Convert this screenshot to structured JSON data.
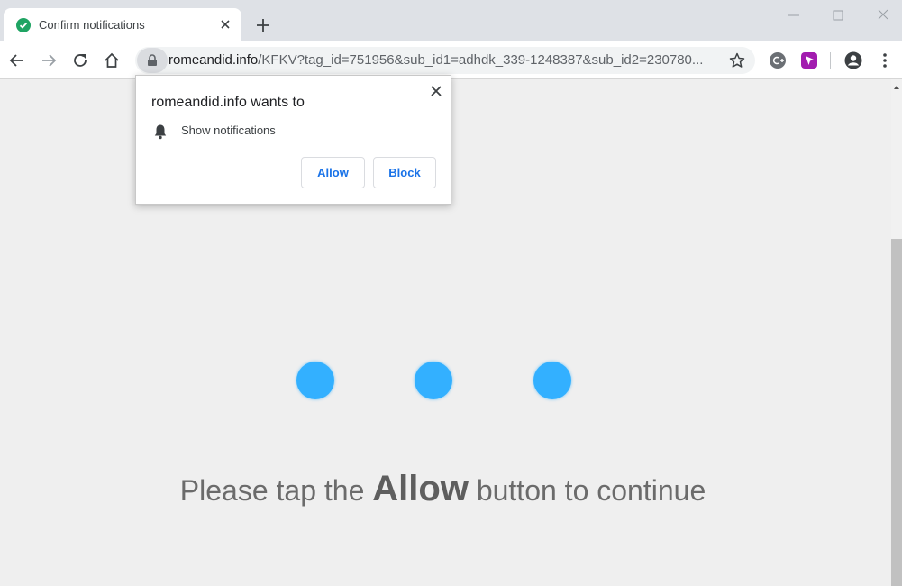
{
  "tab": {
    "title": "Confirm notifications",
    "favicon_icon": "check-circle-icon"
  },
  "window": {
    "minimize_icon": "minimize-icon",
    "maximize_icon": "maximize-icon",
    "close_icon": "close-icon"
  },
  "toolbar": {
    "url_host": "romeandid.info",
    "url_path": "/KFKV?tag_id=751956&sub_id1=adhdk_339-1248387&sub_id2=230780..."
  },
  "popup": {
    "title": "romeandid.info wants to",
    "permission_label": "Show notifications",
    "allow_label": "Allow",
    "block_label": "Block"
  },
  "page": {
    "message_before": "Please tap the ",
    "message_strong": "Allow",
    "message_after": " button to continue",
    "dot_color": "#33b0ff"
  },
  "colors": {
    "accent": "#1a73e8",
    "tab_favicon": "#1fa463"
  }
}
